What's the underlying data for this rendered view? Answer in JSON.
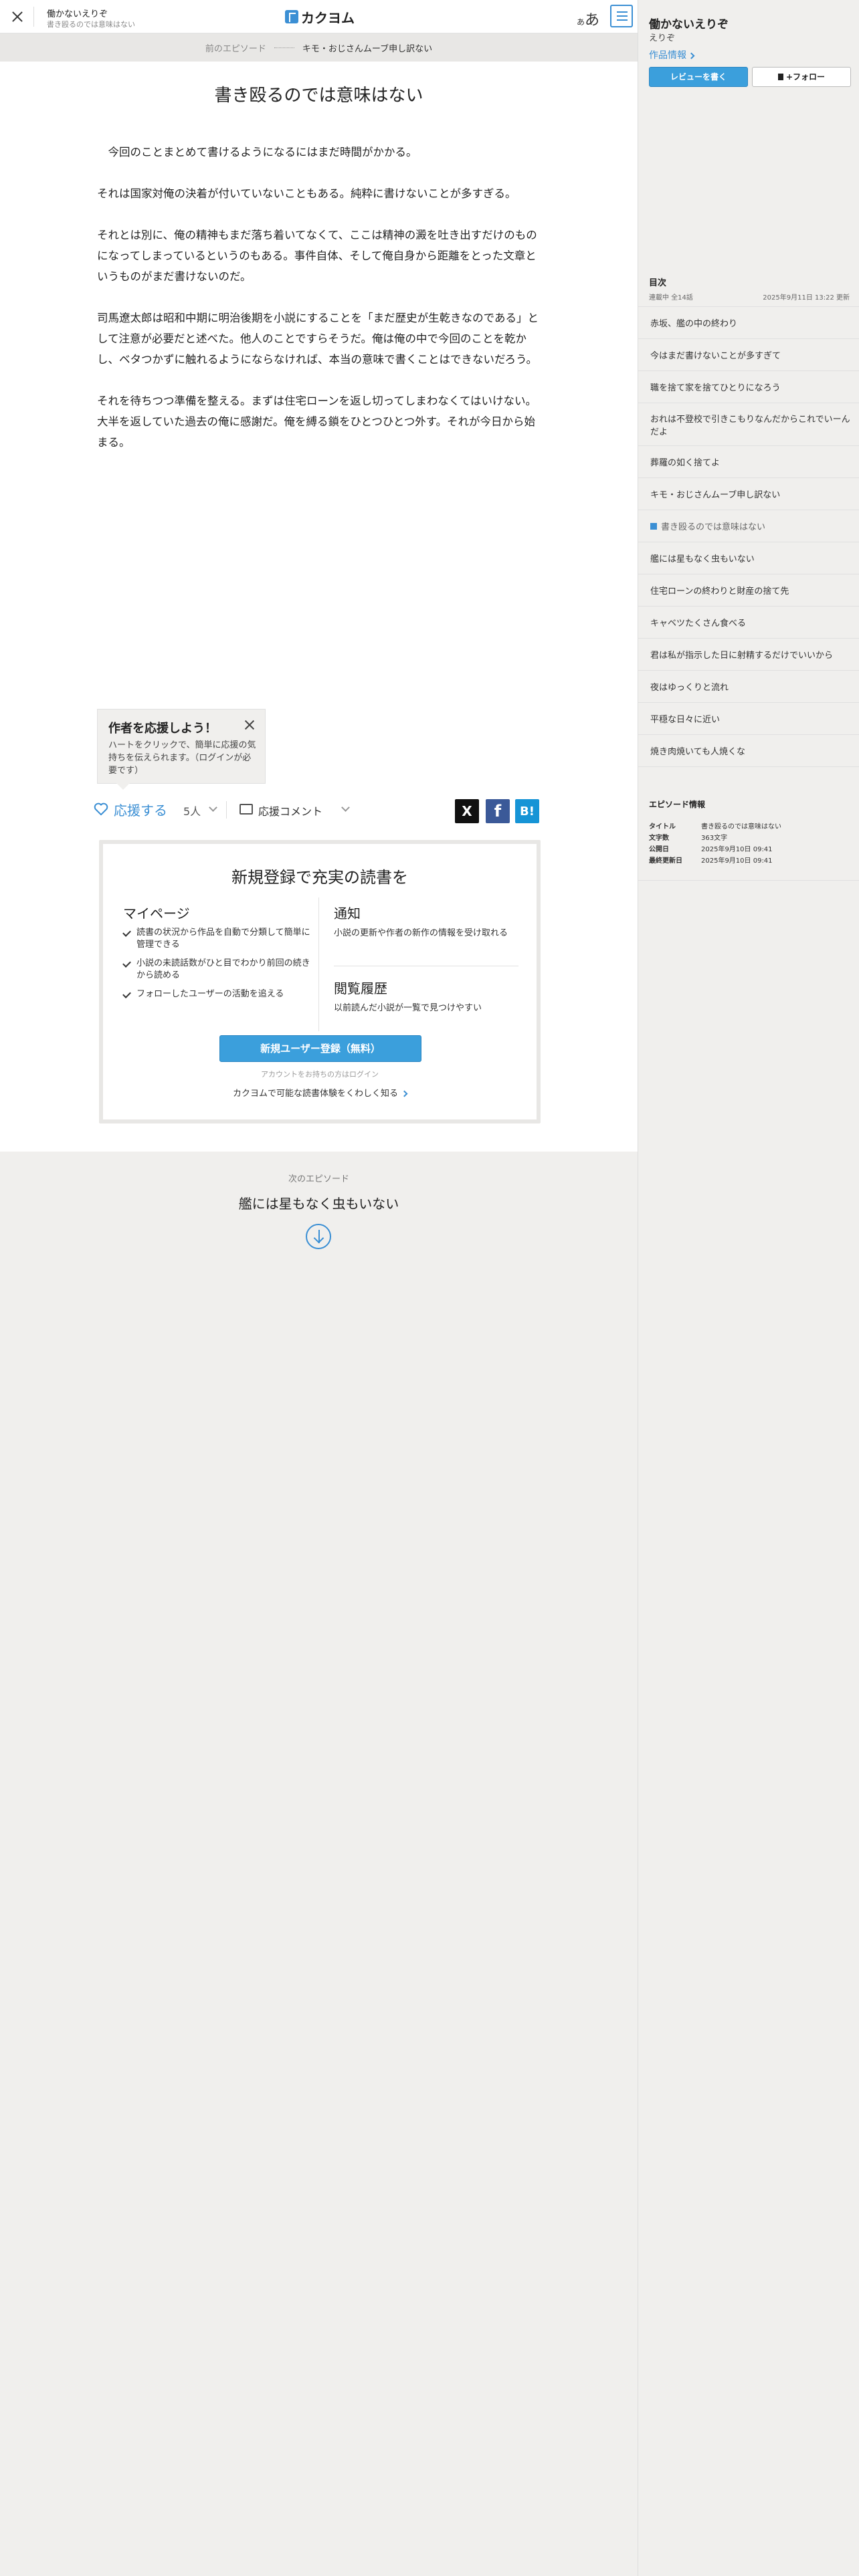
{
  "header": {
    "work_title": "働かないえりぞ",
    "episode_title": "書き殴るのでは意味はない",
    "logo_text": "カクヨム",
    "font_toggle_small": "あ",
    "font_toggle_large": "あ"
  },
  "breadcrumb": {
    "prev_label": "前のエピソード",
    "prev_title": "キモ・おじさんムーブ申し訳ない"
  },
  "episode": {
    "title": "書き殴るのでは意味はない",
    "paragraphs": [
      "　今回のことまとめて書けるようになるにはまだ時間がかかる。",
      "それは国家対俺の決着が付いていないこともある。純粋に書けないことが多すぎる。",
      "それとは別に、俺の精神もまだ落ち着いてなくて、ここは精神の澱を吐き出すだけのものになってしまっているというのもある。事件自体、そして俺自身から距離をとった文章というものがまだ書けないのだ。",
      "司馬遼太郎は昭和中期に明治後期を小説にすることを「まだ歴史が生乾きなのである」として注意が必要だと述べた。他人のことですらそうだ。俺は俺の中で今回のことを乾かし、ベタつかずに触れるようにならなければ、本当の意味で書くことはできないだろう。",
      "それを待ちつつ準備を整える。まずは住宅ローンを返し切ってしまわなくてはいけない。大半を返していた過去の俺に感謝だ。俺を縛る鎖をひとつひとつ外す。それが今日から始まる。"
    ]
  },
  "support_tip": {
    "title": "作者を応援しよう！",
    "body": "ハートをクリックで、簡単に応援の気持ちを伝えられます。（ログインが必要です）"
  },
  "actions": {
    "ouen_label": "応援する",
    "ouen_count": "5人",
    "comment_label": "応援コメント",
    "share_x": "X",
    "share_fb": "f",
    "share_hb": "B!"
  },
  "promo": {
    "title": "新規登録で充実の読書を",
    "mypage_title": "マイページ",
    "mypage_items": [
      "読書の状況から作品を自動で分類して簡単に管理できる",
      "小説の未読話数がひと目でわかり前回の続きから読める",
      "フォローしたユーザーの活動を追える"
    ],
    "notice_title": "通知",
    "notice_desc": "小説の更新や作者の新作の情報を受け取れる",
    "history_title": "閲覧履歴",
    "history_desc": "以前読んだ小説が一覧で見つけやすい",
    "register_label": "新規ユーザー登録（無料）",
    "login_text": "アカウントをお持ちの方はログイン",
    "more_text": "カクヨムで可能な読書体験をくわしく知る"
  },
  "next_episode": {
    "label": "次のエピソード",
    "title": "艦には星もなく虫もいない"
  },
  "sidebar": {
    "work_title": "働かないえりぞ",
    "author": "えりぞ",
    "info_link": "作品情報",
    "review_label": "レビューを書く",
    "follow_label": "フォロー",
    "toc_title": "目次",
    "toc_status": "連載中 全14話",
    "toc_updated": "2025年9月11日 13:22 更新",
    "toc_items": [
      "赤坂、艦の中の終わり",
      "今はまだ書けないことが多すぎて",
      "職を捨て家を捨てひとりになろう",
      "おれは不登校で引きこもりなんだからこれでいーんだよ",
      "葬羅の如く捨てよ",
      "キモ・おじさんムーブ申し訳ない",
      "書き殴るのでは意味はない",
      "艦には星もなく虫もいない",
      "住宅ローンの終わりと財産の捨て先",
      "キャベツたくさん食べる",
      "君は私が指示した日に射精するだけでいいから",
      "夜はゆっくりと流れ",
      "平穏な日々に近い",
      "焼き肉焼いても人焼くな"
    ],
    "epinfo_title": "エピソード情報",
    "epinfo": {
      "title_key": "タイトル",
      "title_val": "書き殴るのでは意味はない",
      "chars_key": "文字数",
      "chars_val": "363文字",
      "pub_key": "公開日",
      "pub_val": "2025年9月10日 09:41",
      "upd_key": "最終更新日",
      "upd_val": "2025年9月10日 09:41"
    }
  },
  "colors": {
    "accent": "#3b8fd4",
    "button": "#3b9fdc",
    "background": "#f0efed"
  }
}
